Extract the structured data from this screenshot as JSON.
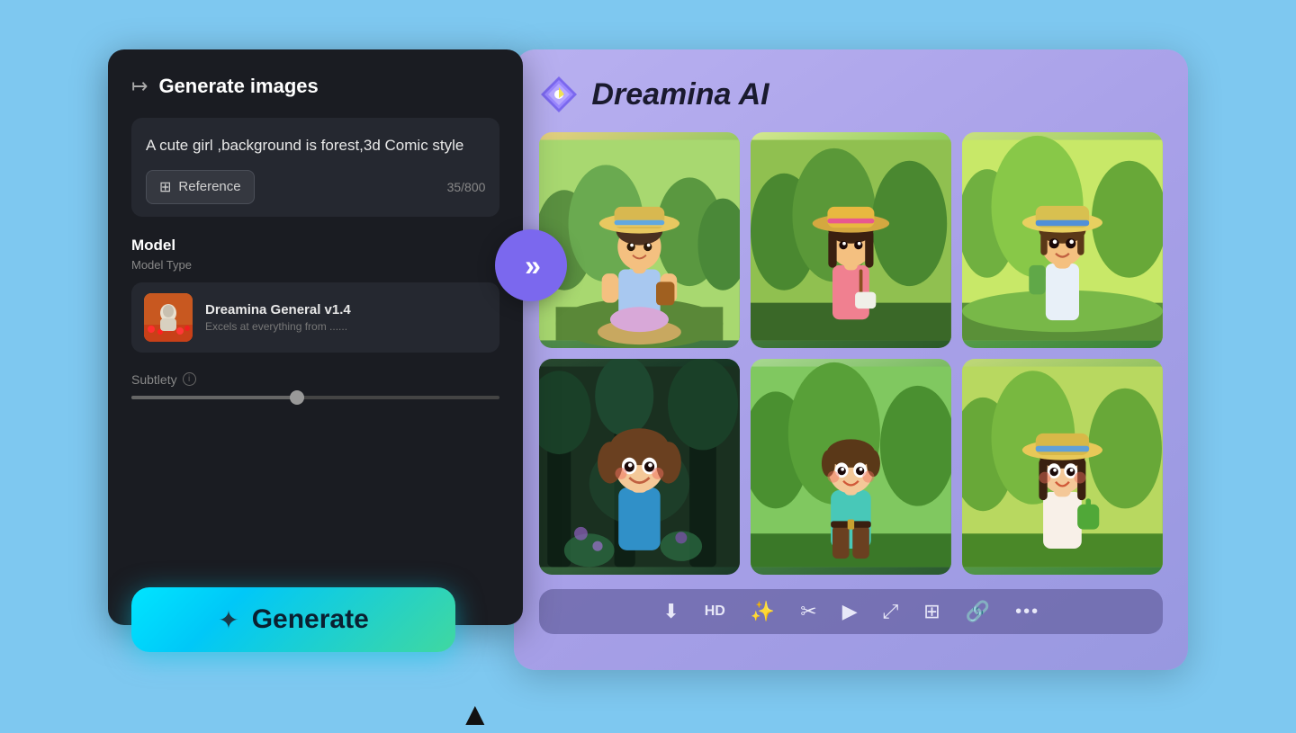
{
  "header": {
    "icon": "↦",
    "title": "Generate images"
  },
  "prompt": {
    "text": "A cute girl ,background is forest,3d Comic style",
    "reference_label": "Reference",
    "char_count": "35/800"
  },
  "model": {
    "section_label": "Model",
    "type_label": "Model Type",
    "name": "Dreamina General v1.4",
    "description": "Excels at everything from ......"
  },
  "subtlety": {
    "label": "Subtlety"
  },
  "generate_btn": {
    "label": "Generate",
    "star_icon": "✦"
  },
  "dreamina": {
    "title": "Dreamina AI",
    "logo_alt": "dreamina-logo"
  },
  "toolbar": {
    "items": [
      {
        "icon": "⬇",
        "label": "download-icon"
      },
      {
        "text": "HD",
        "label": "hd-button"
      },
      {
        "icon": "✨",
        "label": "enhance-icon"
      },
      {
        "icon": "✂",
        "label": "edit-icon"
      },
      {
        "icon": "▶",
        "label": "play-icon"
      },
      {
        "icon": "⤢",
        "label": "expand-icon"
      },
      {
        "icon": "⊞",
        "label": "grid-icon"
      },
      {
        "icon": "🔗",
        "label": "link-icon"
      },
      {
        "icon": "•••",
        "label": "more-icon"
      }
    ]
  }
}
